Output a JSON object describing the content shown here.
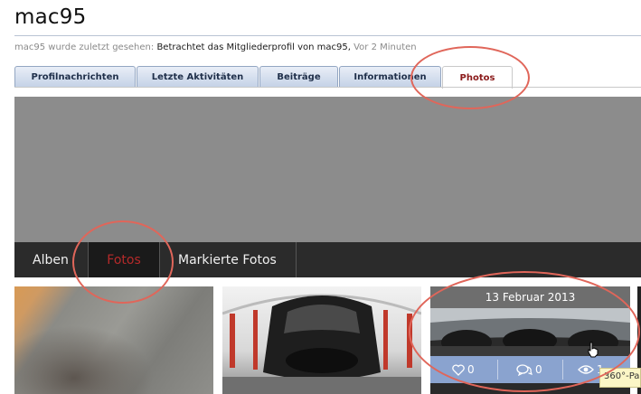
{
  "profile": {
    "username": "mac95",
    "last_seen_prefix": "mac95 wurde zuletzt gesehen:",
    "last_seen_activity": "Betrachtet das Mitgliederprofil von mac95,",
    "last_seen_time": "Vor 2 Minuten"
  },
  "tabs": [
    {
      "label": "Profilnachrichten",
      "active": false
    },
    {
      "label": "Letzte Aktivitäten",
      "active": false
    },
    {
      "label": "Beiträge",
      "active": false
    },
    {
      "label": "Informationen",
      "active": false
    },
    {
      "label": "Photos",
      "active": true
    }
  ],
  "subnav": [
    {
      "label": "Alben",
      "active": false
    },
    {
      "label": "Fotos",
      "active": true
    },
    {
      "label": "Markierte Fotos",
      "active": false
    }
  ],
  "photos": {
    "hovered": {
      "date": "13 Februar 2013",
      "likes": "0",
      "comments": "0",
      "views": "1",
      "tooltip": "360°-Pa"
    }
  },
  "icons": {
    "likes": "heart-icon",
    "comments": "speech-bubbles-icon",
    "views": "eye-icon",
    "cursor": "hand-pointer-icon"
  },
  "colors": {
    "tab_active_text": "#8b1a1a",
    "subnav_active_text": "#b52a2a",
    "stats_bar": "#8aa3cf",
    "annotation": "#e0665a"
  }
}
